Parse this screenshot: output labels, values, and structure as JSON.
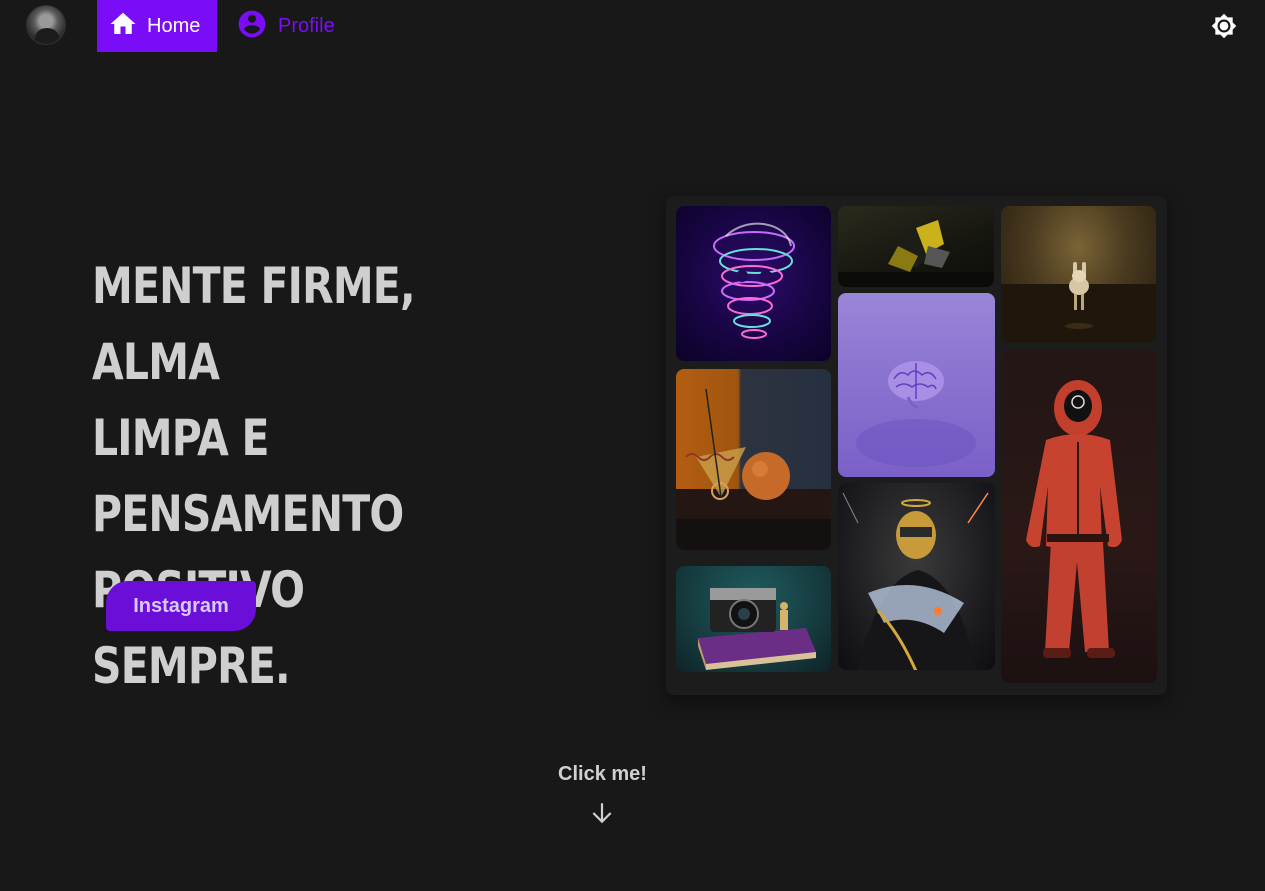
{
  "nav": {
    "home_label": "Home",
    "profile_label": "Profile",
    "active_item": "Home",
    "accent_color": "#7b0cf7"
  },
  "icons": {
    "home": "home-icon",
    "profile": "account-circle-icon",
    "theme": "brightness-icon",
    "arrow": "arrow-down-icon"
  },
  "hero": {
    "title": "Mente firme, alma\nlimpa e\npensamento\npositivo sempre.",
    "button_label": "Instagram",
    "button_color": "#6a0ed8"
  },
  "gallery": {
    "images": [
      "skull-artwork",
      "dark-shapes-artwork",
      "rabbit-artwork",
      "brain-artwork",
      "orange-sphere-artwork",
      "red-suit-artwork",
      "knight-artwork",
      "camera-book-artwork"
    ]
  },
  "footer": {
    "click_label": "Click me!"
  }
}
